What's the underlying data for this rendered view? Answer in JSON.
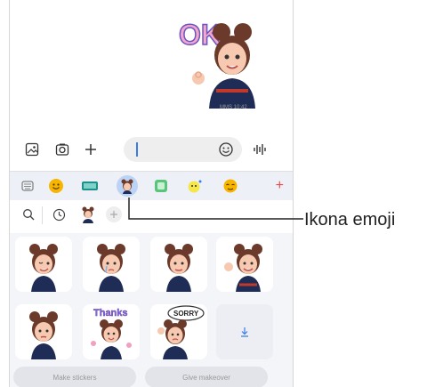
{
  "chat": {
    "timestamp": "MMS 10:42"
  },
  "composer": {
    "icons": [
      "gallery-icon",
      "camera-icon",
      "add-icon",
      "emoji-icon",
      "voice-icon"
    ]
  },
  "tray": {
    "icons": [
      "keyboard-icon",
      "emoji-face-icon",
      "gif-icon",
      "ar-emoji-icon",
      "sticker-icon",
      "bitmoji-icon",
      "stickers-face-icon"
    ],
    "add_label": "+"
  },
  "subrow": {
    "icons": [
      "search-icon",
      "recent-icon",
      "avatar-thumb-icon",
      "add-avatar-icon"
    ]
  },
  "buttons": {
    "make_stickers": "Make stickers",
    "give_makeover": "Give makeover"
  },
  "callout": {
    "label": "Ikona emoji"
  },
  "stickers": {
    "sticker_text_1": "Thanks",
    "sticker_text_2": "SORRY"
  },
  "colors": {
    "accent": "#3b7be8",
    "tray_bg": "#eef0f7",
    "plus_red": "#e84b4b"
  }
}
